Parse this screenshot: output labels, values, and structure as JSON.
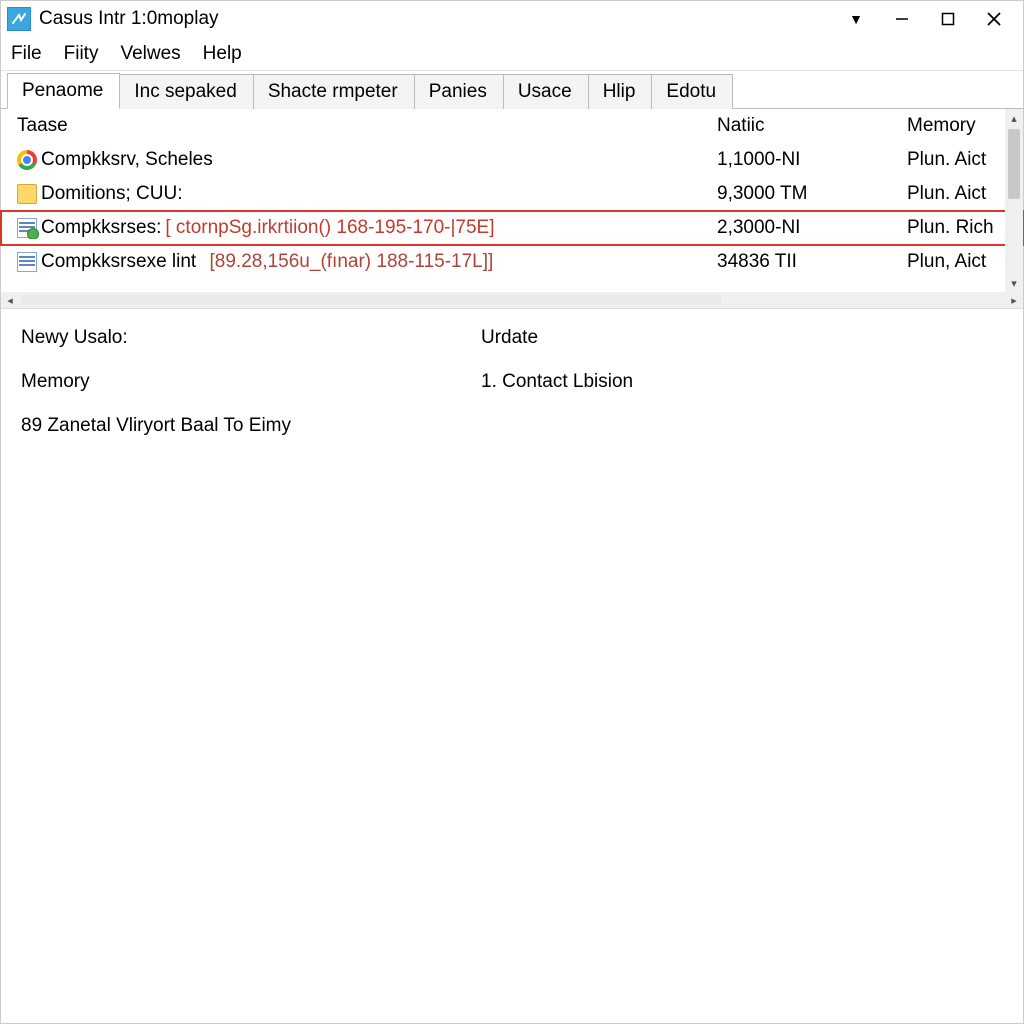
{
  "window": {
    "title": "Casus Intr 1:0moplay"
  },
  "menu": {
    "items": [
      "File",
      "Fiity",
      "Velwes",
      "Help"
    ]
  },
  "tabs": {
    "items": [
      {
        "label": "Penaome",
        "active": true
      },
      {
        "label": "Inc sepaked",
        "active": false
      },
      {
        "label": "Shacte rmpeter",
        "active": false
      },
      {
        "label": "Panies",
        "active": false
      },
      {
        "label": "Usace",
        "active": false
      },
      {
        "label": "Hlip",
        "active": false
      },
      {
        "label": "Edotu",
        "active": false
      }
    ]
  },
  "table": {
    "columns": [
      "Taase",
      "Natiic",
      "Memory"
    ],
    "rows": [
      {
        "icon": "chrome",
        "name": "Compkksrv, Scheles",
        "extra": "",
        "natic": "1,1000-NI",
        "memory": "Plun. Aict",
        "highlight": false,
        "red": false
      },
      {
        "icon": "folder",
        "name": "Domitions; CUU:",
        "extra": "",
        "natic": "9,3000 TM",
        "memory": "Plun. Aict",
        "highlight": false,
        "red": false
      },
      {
        "icon": "docgreen",
        "name": "Compkksrses:",
        "extra": "[ ctornpSg.irkrtiion() 168-195-170-|75E]",
        "natic": "2,3000-NI",
        "memory": "Plun. Rich",
        "highlight": true,
        "red": true
      },
      {
        "icon": "doc",
        "name": "Compkksrsexe lint",
        "extra": "[89.28,156u_(fınar) 188-115-17L]]",
        "natic": "34836 TII",
        "memory": "Plun, Aict",
        "highlight": false,
        "red": true,
        "reddish": true
      }
    ]
  },
  "details": {
    "left1": "Newy Usalo:",
    "right1": "Urdate",
    "left2": "Memory",
    "right2": "1.  Contact Lbision",
    "wide": "89 Zanetal Vliryort Baal To Eimy"
  }
}
